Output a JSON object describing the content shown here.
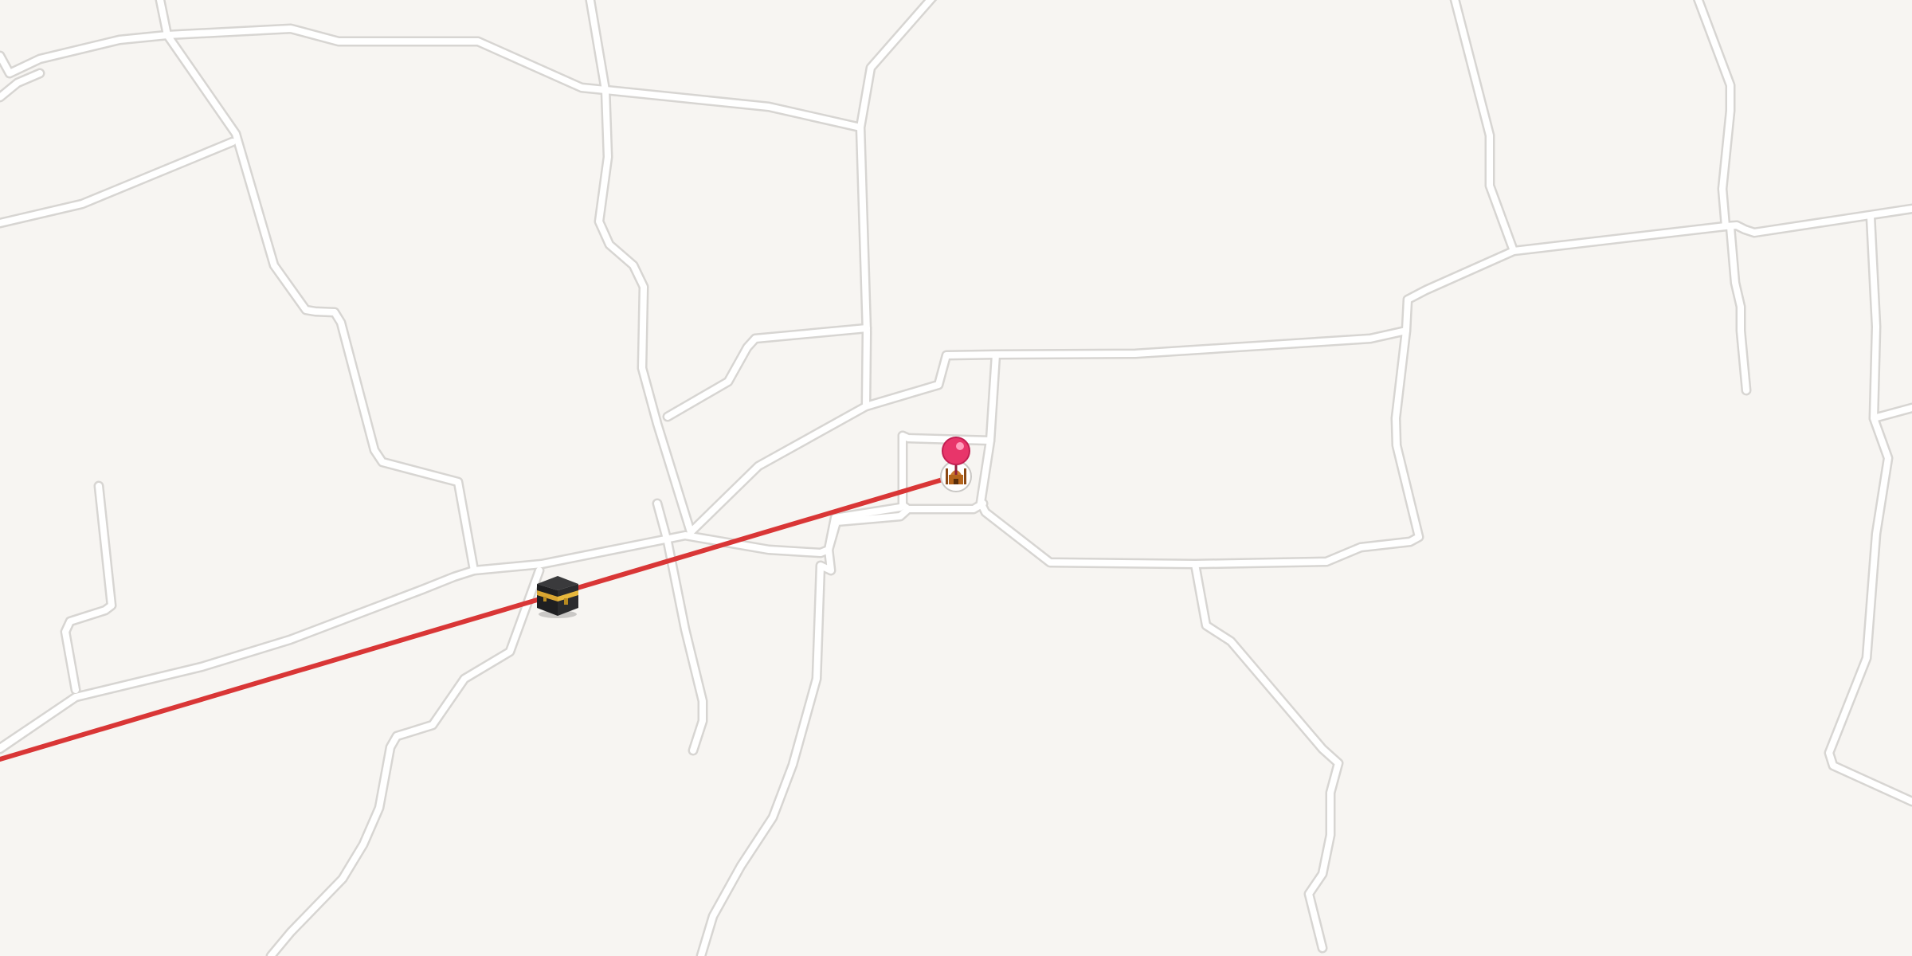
{
  "map": {
    "background_color": "#f7f5f2",
    "road_color": "#ffffff",
    "road_casing_color": "#d7d5d2"
  },
  "route": {
    "description_icon": "qibla-direction-line",
    "color": "#d93636"
  },
  "markers": {
    "kaaba": {
      "icon": "kaaba-icon"
    },
    "location_pin": {
      "icon": "location-pin-icon",
      "color": "#e8356a"
    },
    "mosque": {
      "icon": "mosque-icon"
    }
  }
}
